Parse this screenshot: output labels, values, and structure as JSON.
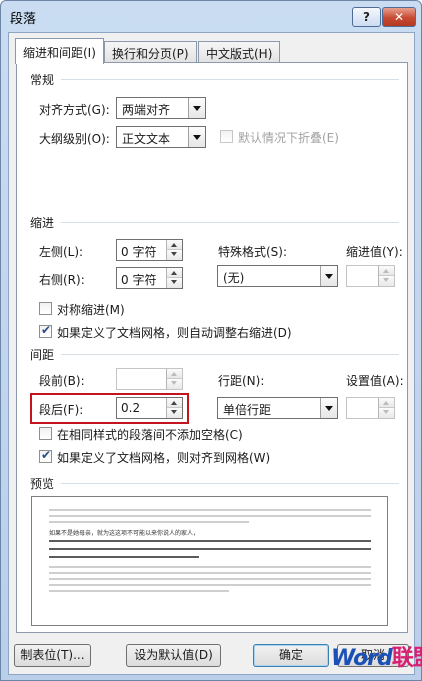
{
  "window": {
    "title": "段落",
    "help_label": "?",
    "close_label": "✕"
  },
  "tabs": [
    {
      "label": "缩进和间距(I)",
      "active": true
    },
    {
      "label": "换行和分页(P)",
      "active": false
    },
    {
      "label": "中文版式(H)",
      "active": false
    }
  ],
  "general": {
    "title": "常规",
    "alignment_label": "对齐方式(G):",
    "alignment_value": "两端对齐",
    "outline_label": "大纲级别(O):",
    "outline_value": "正文文本",
    "collapse_label": "默认情况下折叠(E)"
  },
  "indent": {
    "title": "缩进",
    "left_label": "左侧(L):",
    "left_value": "0 字符",
    "right_label": "右侧(R):",
    "right_value": "0 字符",
    "special_label": "特殊格式(S):",
    "special_value": "(无)",
    "by_label": "缩进值(Y):",
    "by_value": "",
    "mirror_label": "对称缩进(M)",
    "auto_adjust_label": "如果定义了文档网格，则自动调整右缩进(D)"
  },
  "spacing": {
    "title": "间距",
    "before_label": "段前(B):",
    "before_value": "",
    "after_label": "段后(F):",
    "after_value": "0.2",
    "line_label": "行距(N):",
    "line_value": "单倍行距",
    "at_label": "设置值(A):",
    "at_value": "",
    "no_space_label": "在相同样式的段落间不添加空格(C)",
    "snap_grid_label": "如果定义了文档网格，则对齐到网格(W)"
  },
  "preview": {
    "title": "预览",
    "sample_text": "如果不是她母亲，就为这这项不可能以来你说人的家人，"
  },
  "buttons": {
    "tabs_label": "制表位(T)...",
    "default_label": "设为默认值(D)",
    "ok_label": "确定",
    "cancel_label": "取消"
  },
  "watermark": {
    "part1": "Word",
    "part2": "联盟"
  }
}
